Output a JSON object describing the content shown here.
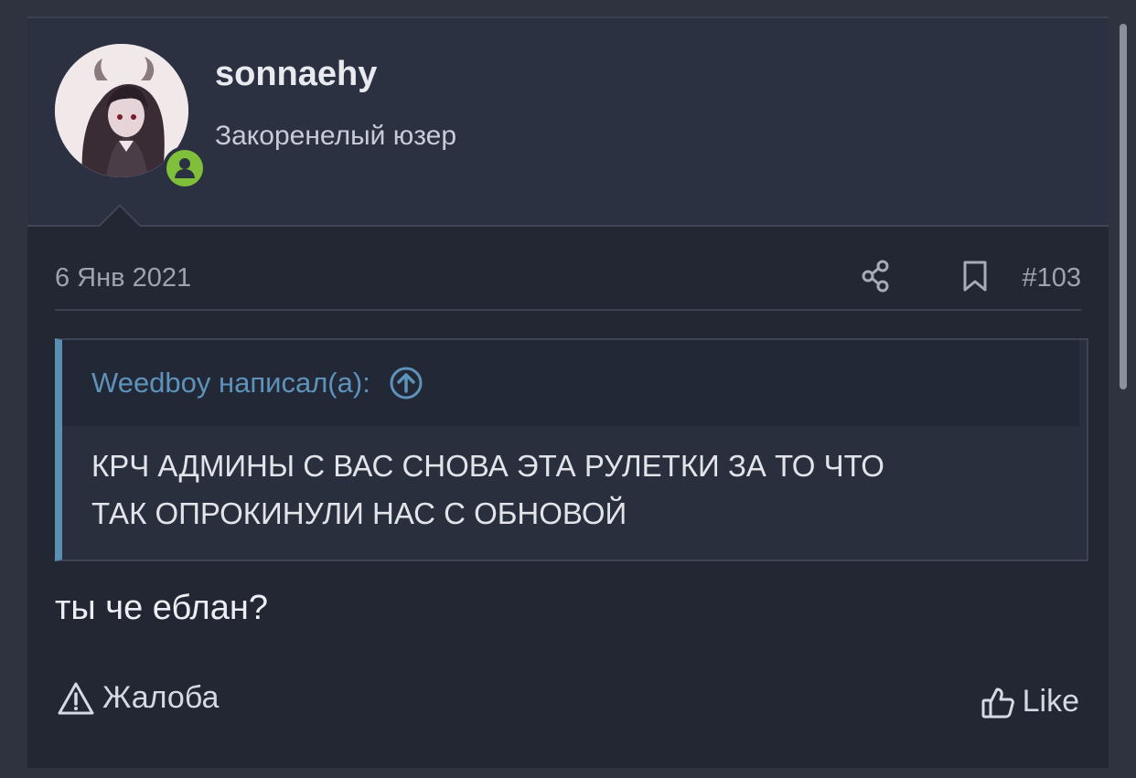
{
  "post": {
    "author": {
      "username": "sonnaehy",
      "title": "Закоренелый юзер",
      "avatar_icon": "user-avatar",
      "online_badge_icon": "user-online-icon",
      "online_color": "#7fbf3a"
    },
    "date": "6 Янв 2021",
    "number": "#103",
    "actions": {
      "share_icon": "share-icon",
      "bookmark_icon": "bookmark-icon"
    },
    "quote": {
      "author_line": "Weedboy написал(а):",
      "jump_icon": "arrow-up-circle-icon",
      "text_line1": "КРЧ АДМИНЫ С ВАС СНОВА ЭТА РУЛЕТКИ ЗА ТО ЧТО",
      "text_line2": "ТАК ОПРОКИНУЛИ НАС С ОБНОВОЙ",
      "accent_color": "#5a8fb2"
    },
    "message": "ты че еблан?",
    "footer": {
      "report_label": "Жалоба",
      "report_icon": "warning-triangle-icon",
      "like_label": "Like",
      "like_icon": "thumbs-up-icon"
    }
  }
}
